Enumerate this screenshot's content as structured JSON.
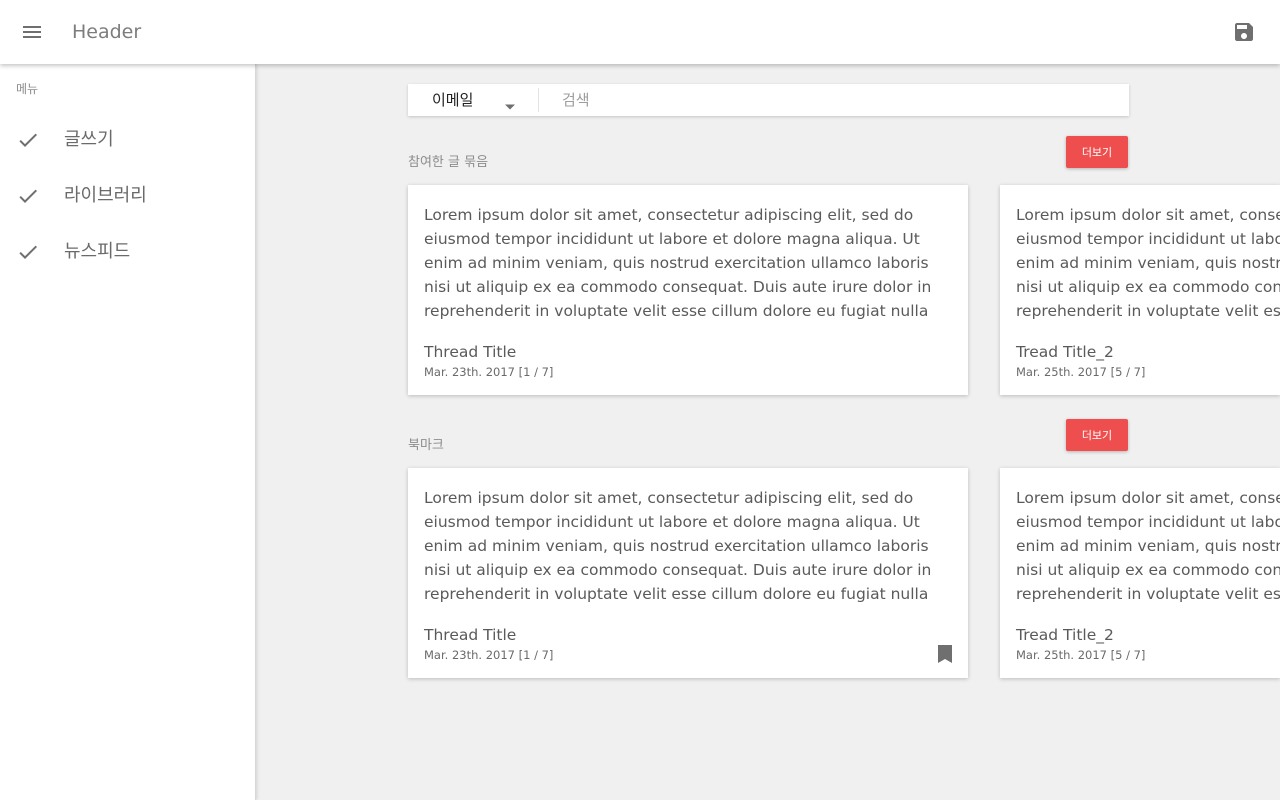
{
  "header": {
    "title": "Header",
    "menu_icon": "menu-icon",
    "save_icon": "save-icon"
  },
  "sidebar": {
    "subheader": "메뉴",
    "items": [
      {
        "label": "글쓰기",
        "icon": "check-icon"
      },
      {
        "label": "라이브러리",
        "icon": "check-icon"
      },
      {
        "label": "뉴스피드",
        "icon": "check-icon"
      }
    ]
  },
  "search": {
    "select_value": "이메일",
    "placeholder": "검색",
    "value": ""
  },
  "sections": {
    "participated": {
      "title": "참여한 글 묶음",
      "more_label": "더보기",
      "cards": [
        {
          "body": "Lorem ipsum dolor sit amet, consectetur adipiscing elit, sed do eiusmod tempor incididunt ut labore et dolore magna aliqua. Ut enim ad minim veniam, quis nostrud exercitation ullamco laboris nisi ut aliquip ex ea commodo consequat. Duis aute irure dolor in reprehenderit in voluptate velit esse cillum dolore eu fugiat nulla pariatur. Excepteur sint occaecat",
          "title": "Thread Title",
          "date": "Mar. 23th. 2017 [1 / 7]"
        },
        {
          "body": "Lorem ipsum dolor sit amet, consectetur adipiscing elit, sed do eiusmod tempor incididunt ut labore et dolore magna aliqua. Ut enim ad minim veniam, quis nostrud exercitation ullamco laboris nisi ut aliquip ex ea commodo consequat. Duis aute irure dolor in reprehenderit in voluptate velit esse cillum dolore eu fugiat nulla pariatur. Excepteur sint occaecat",
          "title": "Tread Title_2",
          "date": "Mar. 25th. 2017 [5 / 7]"
        }
      ]
    },
    "bookmarks": {
      "title": "북마크",
      "more_label": "더보기",
      "cards": [
        {
          "body": "Lorem ipsum dolor sit amet, consectetur adipiscing elit, sed do eiusmod tempor incididunt ut labore et dolore magna aliqua. Ut enim ad minim veniam, quis nostrud exercitation ullamco laboris nisi ut aliquip ex ea commodo consequat. Duis aute irure dolor in reprehenderit in voluptate velit esse cillum dolore eu fugiat nulla pariatur. Excepteur sint occaecat",
          "title": "Thread Title",
          "date": "Mar. 23th. 2017 [1 / 7]",
          "icon": "bookmark-icon"
        },
        {
          "body": "Lorem ipsum dolor sit amet, consectetur adipiscing elit, sed do eiusmod tempor incididunt ut labore et dolore magna aliqua. Ut enim ad minim veniam, quis nostrud exercitation ullamco laboris nisi ut aliquip ex ea commodo consequat. Duis aute irure dolor in reprehenderit in voluptate velit esse cillum dolore eu fugiat nulla pariatur. Excepteur sint occaecat",
          "title": "Tread Title_2",
          "date": "Mar. 25th. 2017 [5 / 7]"
        }
      ]
    }
  },
  "colors": {
    "accent": "#ef4e4e",
    "background": "#f0f0f0",
    "surface": "#ffffff",
    "icon": "#6f6f6f"
  }
}
